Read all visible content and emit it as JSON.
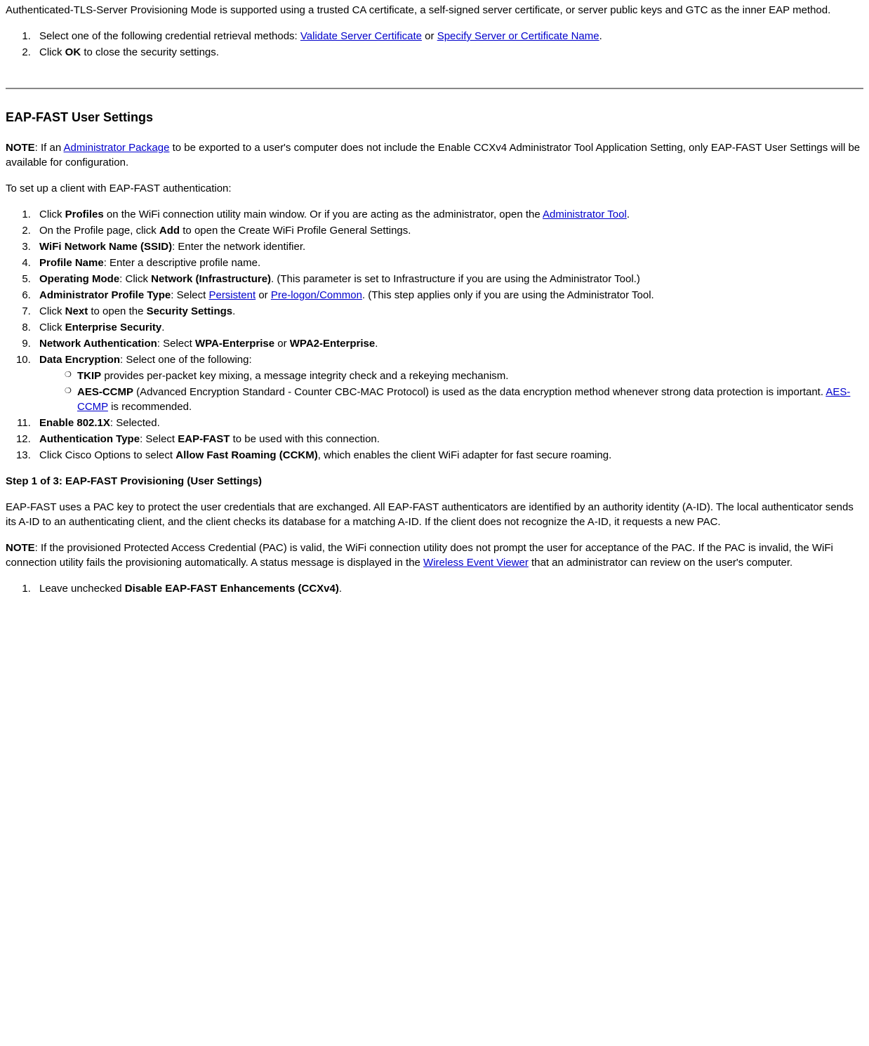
{
  "intro": "Authenticated-TLS-Server Provisioning Mode is supported using a trusted CA certificate, a self-signed server certificate, or server public keys and GTC as the inner EAP method.",
  "top_list": {
    "item1_pre": "Select one of the following credential retrieval methods: ",
    "item1_link1": "Validate Server Certificate",
    "item1_mid": " or ",
    "item1_link2": "Specify Server or Certificate Name",
    "item1_post": ".",
    "item2_pre": "Click ",
    "item2_bold": "OK",
    "item2_post": " to close the security settings."
  },
  "user_heading": "EAP-FAST User Settings",
  "note1": {
    "label": "NOTE",
    "pre": ": If an ",
    "link": "Administrator Package",
    "post": " to be exported to a user's computer does not include the Enable CCXv4 Administrator Tool Application Setting, only EAP-FAST User Settings will be available for configuration."
  },
  "setup_intro": "To set up a client with EAP-FAST authentication:",
  "steps": {
    "s1_pre": "Click ",
    "s1_b1": "Profiles",
    "s1_mid": " on the WiFi connection utility main window. Or if you are acting as the administrator, open the ",
    "s1_link": "Administrator Tool",
    "s1_post": ".",
    "s2_pre": "On the Profile page, click ",
    "s2_b1": "Add",
    "s2_post": " to open the Create WiFi Profile General Settings.",
    "s3_b1": "WiFi Network Name (SSID)",
    "s3_post": ": Enter the network identifier.",
    "s4_b1": "Profile Name",
    "s4_post": ": Enter a descriptive profile name.",
    "s5_b1": "Operating Mode",
    "s5_mid": ": Click ",
    "s5_b2": "Network (Infrastructure)",
    "s5_post": ". (This parameter is set to Infrastructure if you are using the Administrator Tool.)",
    "s6_b1": "Administrator Profile Type",
    "s6_mid": ": Select ",
    "s6_link1": "Persistent",
    "s6_or": " or ",
    "s6_link2": "Pre-logon/Common",
    "s6_post": ". (This step applies only if you are using the Administrator Tool.",
    "s7_pre": "Click ",
    "s7_b1": "Next",
    "s7_mid": " to open the ",
    "s7_b2": "Security Settings",
    "s7_post": ".",
    "s8_pre": "Click ",
    "s8_b1": "Enterprise Security",
    "s8_post": ".",
    "s9_b1": "Network Authentication",
    "s9_mid": ": Select ",
    "s9_b2": "WPA-Enterprise",
    "s9_or": " or ",
    "s9_b3": "WPA2-Enterprise",
    "s9_post": ".",
    "s10_b1": "Data Encryption",
    "s10_post": ": Select one of the following:",
    "s10_sub1_b": "TKIP",
    "s10_sub1_post": " provides per-packet key mixing, a message integrity check and a rekeying mechanism.",
    "s10_sub2_b": "AES-CCMP",
    "s10_sub2_mid": " (Advanced Encryption Standard - Counter CBC-MAC Protocol) is used as the data encryption method whenever strong data protection is important. ",
    "s10_sub2_link": "AES-CCMP",
    "s10_sub2_post": " is recommended.",
    "s11_b1": "Enable 802.1X",
    "s11_post": ": Selected.",
    "s12_b1": "Authentication Type",
    "s12_mid": ": Select ",
    "s12_b2": "EAP-FAST",
    "s12_post": " to be used with this connection.",
    "s13_pre": "Click Cisco Options to select ",
    "s13_b1": "Allow Fast Roaming (CCKM)",
    "s13_post": ", which enables the client WiFi adapter for fast secure roaming."
  },
  "step1_heading": "Step 1 of 3: EAP-FAST Provisioning (User Settings)",
  "step1_para": "EAP-FAST uses a PAC key to protect the user credentials that are exchanged. All EAP-FAST authenticators are identified by an authority identity (A-ID). The local authenticator sends its A-ID to an authenticating client, and the client checks its database for a matching A-ID. If the client does not recognize the A-ID, it requests a new PAC.",
  "note2": {
    "label": "NOTE",
    "pre": ": If the provisioned Protected Access Credential (PAC) is valid, the WiFi connection utility does not prompt the user for acceptance of the PAC. If the PAC is invalid, the WiFi connection utility fails the provisioning automatically. A status message is displayed in the ",
    "link": "Wireless Event Viewer",
    "post": " that an administrator can review on the user's computer."
  },
  "final_list": {
    "item1_pre": "Leave unchecked ",
    "item1_b": "Disable EAP-FAST Enhancements (CCXv4)",
    "item1_post": "."
  }
}
